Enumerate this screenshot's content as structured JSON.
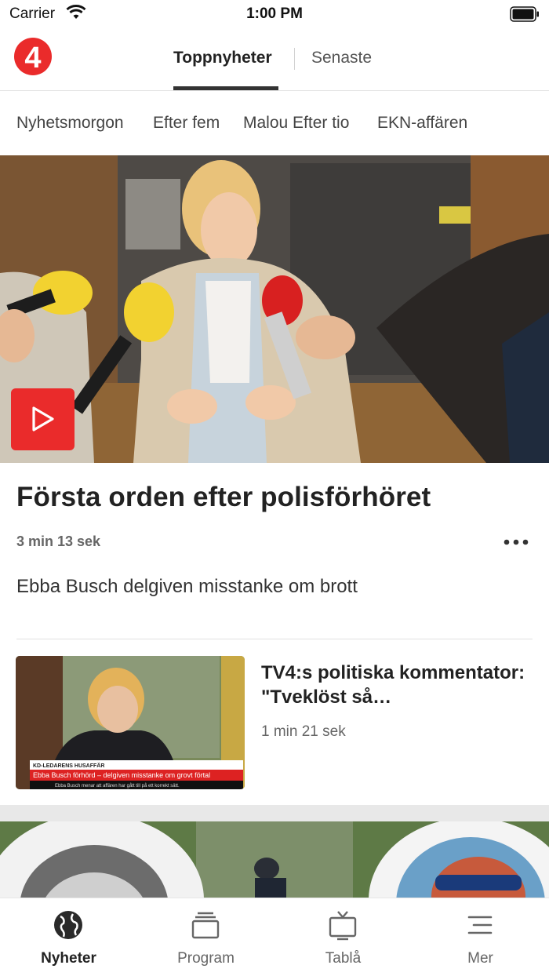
{
  "status_bar": {
    "carrier": "Carrier",
    "time": "1:00 PM"
  },
  "top_nav": {
    "logo_text": "4",
    "tabs": [
      {
        "label": "Toppnyheter",
        "active": true
      },
      {
        "label": "Senaste",
        "active": false
      }
    ]
  },
  "chips": [
    "Nyhetsmorgon",
    "Efter fem",
    "Malou Efter tio",
    "EKN-affären"
  ],
  "featured": {
    "headline": "Första orden efter polisförhöret",
    "duration": "3 min 13 sek",
    "subline": "Ebba Busch delgiven misstanke om brott"
  },
  "card": {
    "title": "TV4:s politiska kommentator: \"Tveklöst så…",
    "duration": "1 min 21 sek",
    "thumb_caption_top": "KD-LEDARENS HUSAFFÄR",
    "thumb_caption": "Ebba Busch förhörd – delgiven misstanke om grovt förtal",
    "thumb_subcaption": "Ebba Busch menar att affären har gått till på ett korrekt sätt."
  },
  "bottom_nav": [
    {
      "label": "Nyheter",
      "icon": "globe-icon",
      "active": true
    },
    {
      "label": "Program",
      "icon": "stack-icon",
      "active": false
    },
    {
      "label": "Tablå",
      "icon": "tv-icon",
      "active": false
    },
    {
      "label": "Mer",
      "icon": "menu-icon",
      "active": false
    }
  ],
  "colors": {
    "brand_red": "#ea2b2b",
    "text_dark": "#222222",
    "text_muted": "#666666"
  }
}
